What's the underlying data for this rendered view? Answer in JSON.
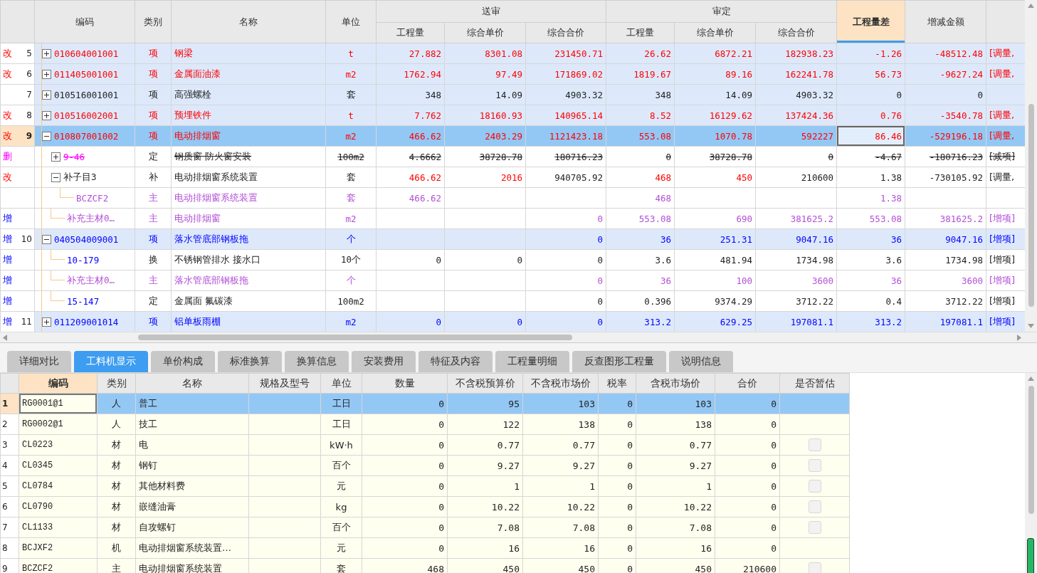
{
  "top_table": {
    "columns": [
      {
        "label": "编码",
        "selected": false
      },
      {
        "label": "类别",
        "selected": false
      },
      {
        "label": "名称",
        "selected": false
      },
      {
        "label": "单位",
        "selected": false
      },
      {
        "label": "送审",
        "children": [
          {
            "label": "工程量",
            "selected": false
          },
          {
            "label": "综合单价",
            "selected": false
          },
          {
            "label": "综合合价",
            "selected": false
          }
        ]
      },
      {
        "label": "审定",
        "children": [
          {
            "label": "工程量",
            "selected": false
          },
          {
            "label": "综合单价",
            "selected": false
          },
          {
            "label": "综合合价",
            "selected": false
          }
        ]
      },
      {
        "label": "工程量差",
        "selected": true
      },
      {
        "label": "增减金额",
        "selected": false
      },
      {
        "selected": false
      }
    ],
    "rows": [
      {
        "mark": {
          "text": "改",
          "kind": "modified"
        },
        "num": "5",
        "expanded": false,
        "code": {
          "text": "010604001001",
          "kind": "modified"
        },
        "type": "项",
        "name": "钢梁",
        "unit": "t",
        "kind": "modified",
        "struck": false,
        "selected": false,
        "values": {
          "sent_qty": "27.882",
          "sent_price": "8301.08",
          "sent_total": "231450.71",
          "approved_qty": "26.62",
          "approved_price": "6872.21",
          "approved_total": "182938.23",
          "qty_diff": "-1.26",
          "amount_diff": "-48512.48"
        },
        "note": "[调量,"
      },
      {
        "mark": {
          "text": "改",
          "kind": "modified"
        },
        "num": "6",
        "expanded": false,
        "code": {
          "text": "011405001001",
          "kind": "modified"
        },
        "type": "项",
        "name": "金属面油漆",
        "unit": "m2",
        "kind": "modified",
        "struck": false,
        "selected": false,
        "values": {
          "sent_qty": "1762.94",
          "sent_price": "97.49",
          "sent_total": "171869.02",
          "approved_qty": "1819.67",
          "approved_price": "89.16",
          "approved_total": "162241.78",
          "qty_diff": "56.73",
          "amount_diff": "-9627.24"
        },
        "note": "[调量,"
      },
      {
        "num": "7",
        "expanded": false,
        "code": {
          "text": "010516001001",
          "kind": "plain"
        },
        "type": "项",
        "name": "高强螺栓",
        "unit": "套",
        "kind": "plain",
        "struck": false,
        "selected": false,
        "values": {
          "sent_qty": "348",
          "sent_price": "14.09",
          "sent_total": "4903.32",
          "approved_qty": "348",
          "approved_price": "14.09",
          "approved_total": "4903.32",
          "qty_diff": "0",
          "amount_diff": "0"
        }
      },
      {
        "mark": {
          "text": "改",
          "kind": "modified"
        },
        "num": "8",
        "expanded": false,
        "code": {
          "text": "010516002001",
          "kind": "modified"
        },
        "type": "项",
        "name": "预埋铁件",
        "unit": "t",
        "kind": "modified",
        "struck": false,
        "selected": false,
        "values": {
          "sent_qty": "7.762",
          "sent_price": "18160.93",
          "sent_total": "140965.14",
          "approved_qty": "8.52",
          "approved_price": "16129.62",
          "approved_total": "137424.36",
          "qty_diff": "0.76",
          "amount_diff": "-3540.78"
        },
        "note": "[调量,"
      },
      {
        "mark": {
          "text": "改",
          "kind": "modified"
        },
        "num": "9",
        "expanded": true,
        "code": {
          "text": "010807001002",
          "kind": "modified"
        },
        "type": "项",
        "name": "电动排烟窗",
        "unit": "m2",
        "kind": "modified",
        "struck": false,
        "selected": true,
        "values": {
          "sent_qty": "466.62",
          "sent_price": "2403.29",
          "sent_total": "1121423.18",
          "approved_qty": "553.08",
          "approved_price": "1070.78",
          "approved_total": "592227",
          "qty_diff": "86.46",
          "amount_diff": "-529196.18"
        },
        "note": "[调量,",
        "children": [
          {
            "mark": {
              "text": "删",
              "kind": "deleted"
            },
            "expanded": false,
            "code": {
              "text": "9-46",
              "kind": "deleted"
            },
            "type": "定",
            "name": "钢质窗 防火窗安装",
            "unit": "100m2",
            "kind": "plain",
            "struck": true,
            "selected": false,
            "values": {
              "sent_qty": "4.6662",
              "sent_price": "38728.78",
              "sent_total": "180716.23",
              "approved_qty": "0",
              "approved_price": "38728.78",
              "approved_total": "0",
              "qty_diff": "-4.67",
              "amount_diff": "-180716.23"
            },
            "note": "[减项]"
          },
          {
            "mark": {
              "text": "改",
              "kind": "modified"
            },
            "expanded": true,
            "code": {
              "text": "补子目3",
              "kind": "plain"
            },
            "type": "补",
            "name": "电动排烟窗系统装置",
            "unit": "套",
            "kind": "plain",
            "struck": false,
            "selected": false,
            "values": {
              "sent_qty": "466.62",
              "sent_price": "2016",
              "sent_total": "940705.92",
              "approved_qty": "468",
              "approved_price": "450",
              "approved_total": "210600",
              "qty_diff": "1.38",
              "amount_diff": "-730105.92"
            },
            "changed": {
              "sent_qty": true,
              "sent_price": true,
              "sent_total": false,
              "approved_qty": true,
              "approved_price": true,
              "approved_total": false,
              "qty_diff": false,
              "amount_diff": false
            },
            "note": "[调量,",
            "children": [
              {
                "code": {
                  "text": "BCZCF2",
                  "kind": "main"
                },
                "type": "主",
                "name": "电动排烟窗系统装置",
                "unit": "套",
                "kind": "main",
                "struck": false,
                "selected": false,
                "values": {
                  "sent_qty": "466.62",
                  "approved_qty": "468",
                  "qty_diff": "1.38"
                }
              }
            ]
          },
          {
            "mark": {
              "text": "增",
              "kind": "added"
            },
            "code": {
              "text": "补充主材0…",
              "kind": "main"
            },
            "type": "主",
            "name": "电动排烟窗",
            "unit": "m2",
            "kind": "main",
            "struck": false,
            "selected": false,
            "values": {
              "sent_total": "0",
              "approved_qty": "553.08",
              "approved_price": "690",
              "approved_total": "381625.2",
              "qty_diff": "553.08",
              "amount_diff": "381625.2"
            },
            "note": "[增项]"
          }
        ]
      },
      {
        "mark": {
          "text": "增",
          "kind": "added"
        },
        "num": "10",
        "expanded": true,
        "code": {
          "text": "040504009001",
          "kind": "added"
        },
        "type": "项",
        "name": "落水管底部钢板拖",
        "unit": "个",
        "kind": "added",
        "struck": false,
        "selected": false,
        "values": {
          "sent_total": "0",
          "approved_qty": "36",
          "approved_price": "251.31",
          "approved_total": "9047.16",
          "qty_diff": "36",
          "amount_diff": "9047.16"
        },
        "note": "[增项]",
        "children": [
          {
            "mark": {
              "text": "增",
              "kind": "added"
            },
            "code": {
              "text": "10-179",
              "kind": "added"
            },
            "type": "换",
            "name": "不锈钢管排水 接水口",
            "unit": "10个",
            "kind": "plain",
            "struck": false,
            "selected": false,
            "values": {
              "sent_qty": "0",
              "sent_price": "0",
              "sent_total": "0",
              "approved_qty": "3.6",
              "approved_price": "481.94",
              "approved_total": "1734.98",
              "qty_diff": "3.6",
              "amount_diff": "1734.98"
            },
            "note": "[增项]"
          },
          {
            "mark": {
              "text": "增",
              "kind": "added"
            },
            "code": {
              "text": "补充主材0…",
              "kind": "main"
            },
            "type": "主",
            "name": "落水管底部钢板拖",
            "unit": "个",
            "kind": "main",
            "struck": false,
            "selected": false,
            "values": {
              "sent_total": "0",
              "approved_qty": "36",
              "approved_price": "100",
              "approved_total": "3600",
              "qty_diff": "36",
              "amount_diff": "3600"
            },
            "note": "[增项]"
          },
          {
            "mark": {
              "text": "增",
              "kind": "added"
            },
            "code": {
              "text": "15-147",
              "kind": "added"
            },
            "type": "定",
            "name": "金属面 氟碳漆",
            "unit": "100m2",
            "kind": "plain",
            "struck": false,
            "selected": false,
            "values": {
              "sent_total": "0",
              "approved_qty": "0.396",
              "approved_price": "9374.29",
              "approved_total": "3712.22",
              "qty_diff": "0.4",
              "amount_diff": "3712.22"
            },
            "note": "[增项]"
          }
        ]
      },
      {
        "mark": {
          "text": "增",
          "kind": "added"
        },
        "num": "11",
        "expanded": false,
        "code": {
          "text": "011209001014",
          "kind": "added"
        },
        "type": "项",
        "name": "铝单板雨棚",
        "unit": "m2",
        "kind": "added",
        "struck": false,
        "selected": false,
        "values": {
          "sent_qty": "0",
          "sent_price": "0",
          "sent_total": "0",
          "approved_qty": "313.2",
          "approved_price": "629.25",
          "approved_total": "197081.1",
          "qty_diff": "313.2",
          "amount_diff": "197081.1"
        },
        "note": "[增项]"
      }
    ]
  },
  "tabs": [
    {
      "label": "详细对比",
      "selected": false
    },
    {
      "label": "工料机显示",
      "selected": true
    },
    {
      "label": "单价构成",
      "selected": false
    },
    {
      "label": "标准换算",
      "selected": false
    },
    {
      "label": "换算信息",
      "selected": false
    },
    {
      "label": "安装费用",
      "selected": false
    },
    {
      "label": "特征及内容",
      "selected": false
    },
    {
      "label": "工程量明细",
      "selected": false
    },
    {
      "label": "反查图形工程量",
      "selected": false
    },
    {
      "label": "说明信息",
      "selected": false
    }
  ],
  "bottom_table": {
    "columns": [
      {
        "label": "编码",
        "selected": true
      },
      {
        "label": "类别",
        "selected": false
      },
      {
        "label": "名称",
        "selected": false
      },
      {
        "label": "规格及型号",
        "selected": false
      },
      {
        "label": "单位",
        "selected": false
      },
      {
        "label": "数量",
        "selected": false
      },
      {
        "label": "不含税预算价",
        "selected": false
      },
      {
        "label": "不含税市场价",
        "selected": false
      },
      {
        "label": "税率",
        "selected": false
      },
      {
        "label": "含税市场价",
        "selected": false
      },
      {
        "label": "合价",
        "selected": false
      },
      {
        "label": "是否暂估",
        "selected": false
      }
    ],
    "rows": [
      {
        "num": "1",
        "selected": true,
        "code": "RG0001@1",
        "type": "人",
        "name": "普工",
        "unit": "工日",
        "qty": "0",
        "budget_price": "95",
        "market_price": "103",
        "tax_rate": "0",
        "taxed_price": "103",
        "total": "0"
      },
      {
        "num": "2",
        "selected": false,
        "code": "RG0002@1",
        "type": "人",
        "name": "技工",
        "unit": "工日",
        "qty": "0",
        "budget_price": "122",
        "market_price": "138",
        "tax_rate": "0",
        "taxed_price": "138",
        "total": "0"
      },
      {
        "num": "3",
        "selected": false,
        "code": "CL0223",
        "type": "材",
        "name": "电",
        "unit": "kW·h",
        "qty": "0",
        "budget_price": "0.77",
        "market_price": "0.77",
        "tax_rate": "0",
        "taxed_price": "0.77",
        "total": "0",
        "estimated": false
      },
      {
        "num": "4",
        "selected": false,
        "code": "CL0345",
        "type": "材",
        "name": "钢钉",
        "unit": "百个",
        "qty": "0",
        "budget_price": "9.27",
        "market_price": "9.27",
        "tax_rate": "0",
        "taxed_price": "9.27",
        "total": "0",
        "estimated": false
      },
      {
        "num": "5",
        "selected": false,
        "code": "CL0784",
        "type": "材",
        "name": "其他材料费",
        "unit": "元",
        "qty": "0",
        "budget_price": "1",
        "market_price": "1",
        "tax_rate": "0",
        "taxed_price": "1",
        "total": "0",
        "estimated": false
      },
      {
        "num": "6",
        "selected": false,
        "code": "CL0790",
        "type": "材",
        "name": "嵌缝油膏",
        "unit": "kg",
        "qty": "0",
        "budget_price": "10.22",
        "market_price": "10.22",
        "tax_rate": "0",
        "taxed_price": "10.22",
        "total": "0",
        "estimated": false
      },
      {
        "num": "7",
        "selected": false,
        "code": "CL1133",
        "type": "材",
        "name": "自攻螺钉",
        "unit": "百个",
        "qty": "0",
        "budget_price": "7.08",
        "market_price": "7.08",
        "tax_rate": "0",
        "taxed_price": "7.08",
        "total": "0",
        "estimated": false
      },
      {
        "num": "8",
        "selected": false,
        "code": "BCJXF2",
        "type": "机",
        "name": "电动排烟窗系统装置…",
        "unit": "元",
        "qty": "0",
        "budget_price": "16",
        "market_price": "16",
        "tax_rate": "0",
        "taxed_price": "16",
        "total": "0"
      },
      {
        "num": "9",
        "selected": false,
        "code": "BCZCF2",
        "type": "主",
        "name": "电动排烟窗系统装置",
        "unit": "套",
        "qty": "468",
        "budget_price": "450",
        "market_price": "450",
        "tax_rate": "0",
        "taxed_price": "450",
        "total": "210600",
        "estimated": false
      }
    ]
  }
}
